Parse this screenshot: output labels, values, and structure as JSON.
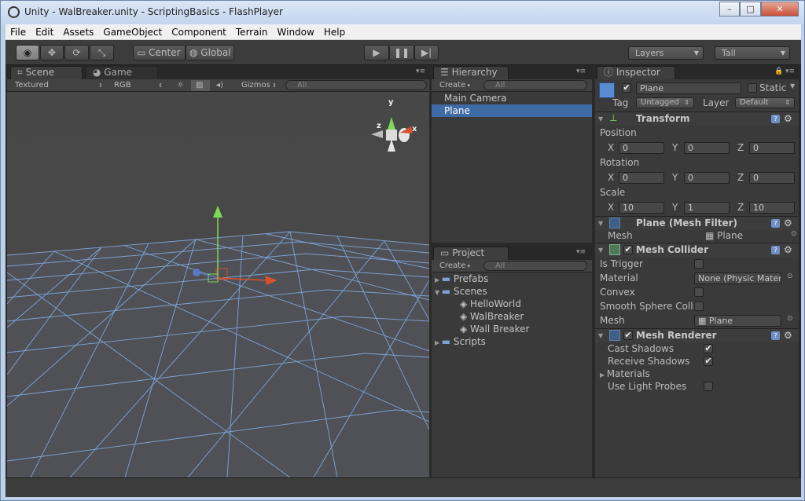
{
  "window": {
    "title": "Unity - WalBreaker.unity - ScriptingBasics - FlashPlayer",
    "minimize": "–",
    "maximize": "□",
    "close": "✕"
  },
  "menu": [
    "File",
    "Edit",
    "Assets",
    "GameObject",
    "Component",
    "Terrain",
    "Window",
    "Help"
  ],
  "toolbar": {
    "pivot": "Center",
    "space": "Global",
    "layers": "Layers",
    "layout": "Tall"
  },
  "scene": {
    "tab_scene": "Scene",
    "tab_game": "Game",
    "render_mode": "Textured",
    "color_mode": "RGB",
    "gizmos": "Gizmos",
    "search_placeholder": "All",
    "axis_x": "x",
    "axis_y": "y",
    "axis_z": "z"
  },
  "hierarchy": {
    "tab": "Hierarchy",
    "create": "Create",
    "search_placeholder": "All",
    "items": [
      "Main Camera",
      "Plane"
    ],
    "selected": "Plane"
  },
  "project": {
    "tab": "Project",
    "create": "Create",
    "search_placeholder": "All",
    "folders": [
      {
        "name": "Prefabs"
      },
      {
        "name": "Scenes",
        "children": [
          "HelloWorld",
          "WalBreaker",
          "Wall Breaker"
        ]
      },
      {
        "name": "Scripts"
      }
    ]
  },
  "inspector": {
    "tab": "Inspector",
    "object_name": "Plane",
    "static_label": "Static",
    "tag_label": "Tag",
    "tag_value": "Untagged",
    "layer_label": "Layer",
    "layer_value": "Default",
    "transform": {
      "title": "Transform",
      "position_label": "Position",
      "rotation_label": "Rotation",
      "scale_label": "Scale",
      "x": "X",
      "y": "Y",
      "z": "Z",
      "position": [
        "0",
        "0",
        "0"
      ],
      "rotation": [
        "0",
        "0",
        "0"
      ],
      "scale": [
        "10",
        "1",
        "10"
      ]
    },
    "mesh_filter": {
      "title": "Plane (Mesh Filter)",
      "mesh_label": "Mesh",
      "mesh_value": "Plane"
    },
    "mesh_collider": {
      "title": "Mesh Collider",
      "is_trigger": "Is Trigger",
      "material": "Material",
      "material_value": "None (Physic Mater",
      "convex": "Convex",
      "smooth": "Smooth Sphere Colli",
      "mesh_label": "Mesh",
      "mesh_value": "Plane"
    },
    "mesh_renderer": {
      "title": "Mesh Renderer",
      "cast_shadows": "Cast Shadows",
      "receive_shadows": "Receive Shadows",
      "materials": "Materials",
      "light_probes": "Use Light Probes"
    },
    "check": "✔"
  }
}
